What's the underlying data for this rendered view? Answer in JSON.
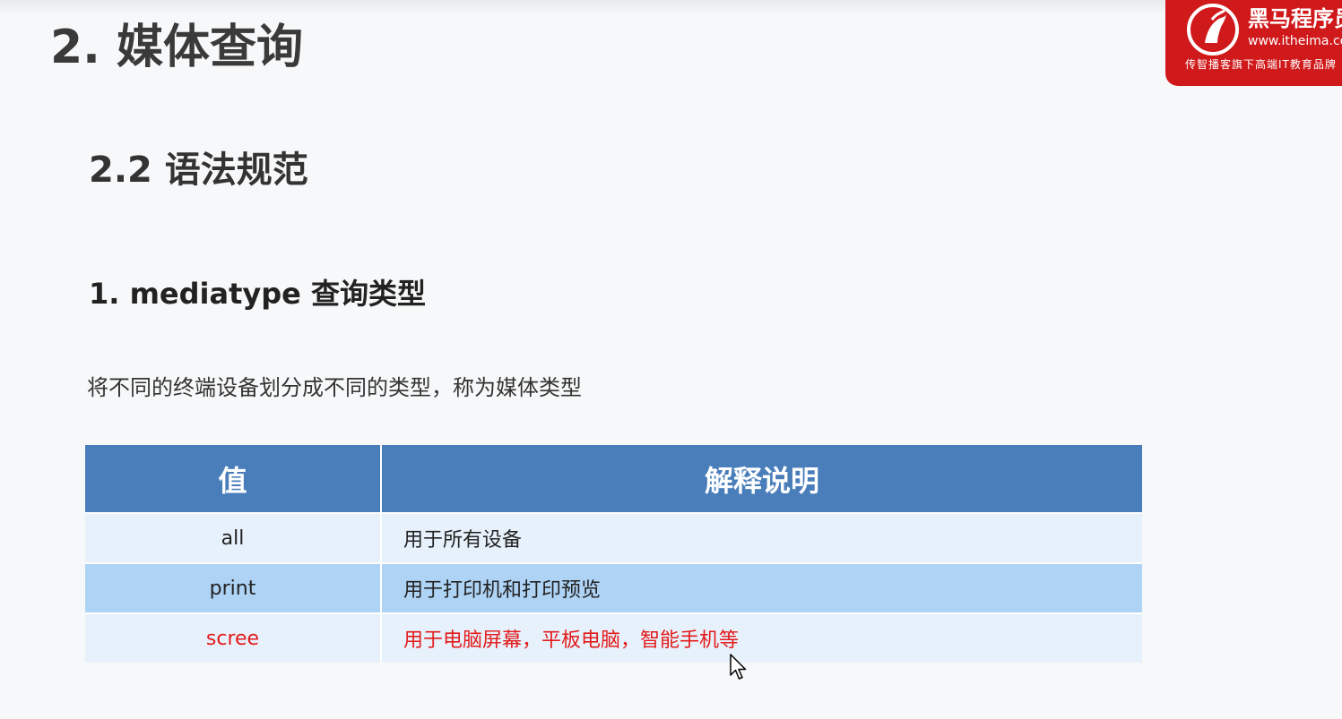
{
  "slide": {
    "title": "2. 媒体查询",
    "subtitle": "2.2 语法规范",
    "section": "1. mediatype 查询类型",
    "description": "将不同的终端设备划分成不同的类型，称为媒体类型"
  },
  "logo": {
    "name": "黑马程序员",
    "url": "www.itheima.com",
    "slogan": "传智播客旗下高端IT教育品牌",
    "color": "#d0191b"
  },
  "table": {
    "headers": [
      "值",
      "解释说明"
    ],
    "rows": [
      {
        "value": "all",
        "explanation": "用于所有设备"
      },
      {
        "value": "print",
        "explanation": "用于打印机和打印预览"
      },
      {
        "value": "scree",
        "explanation": "用于电脑屏幕，平板电脑，智能手机等"
      }
    ],
    "colors": {
      "header": "#4a7ebb",
      "row_light": "#e7f1fb",
      "row_mid": "#aed3f5",
      "highlight_text": "#e31b1b"
    }
  },
  "icons": {
    "cursor": "mouse-pointer-icon",
    "logo_mark": "horse-logo-icon"
  }
}
